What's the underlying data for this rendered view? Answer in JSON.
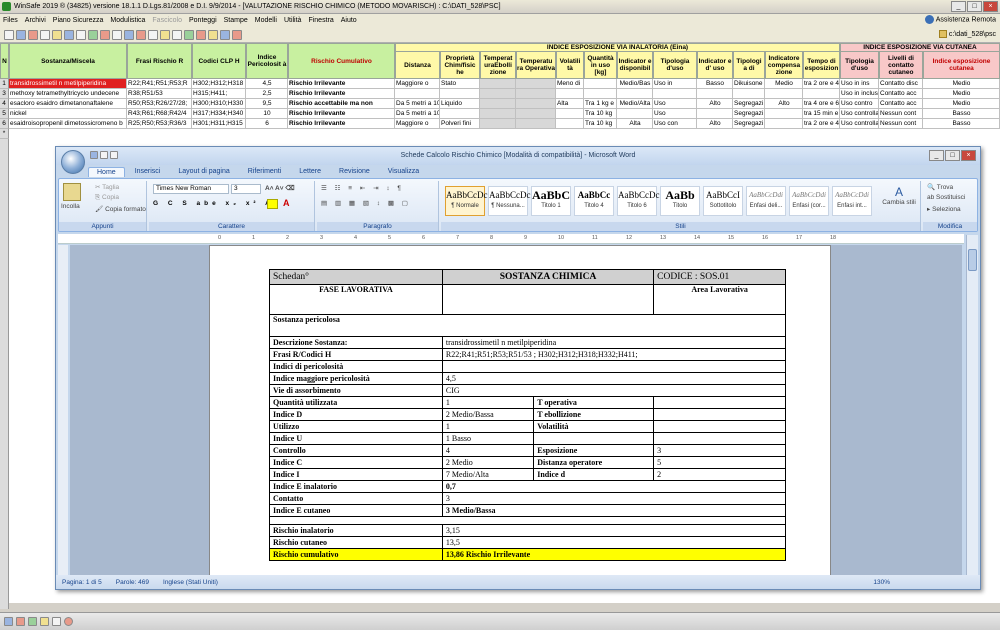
{
  "app": {
    "title": "WinSafe 2019 ®     (34825)  versione 18.1.1   D.Lgs.81/2008 e D.I. 9/9/2014 - [VALUTAZIONE RISCHIO CHIMICO (METODO MOVARISCH) : C:\\DATI_528\\PSC]"
  },
  "menu": [
    "Files",
    "Archivi",
    "Piano Sicurezza",
    "Modulistica",
    "Fascicolo",
    "Ponteggi",
    "Stampe",
    "Modelli",
    "Utilità",
    "Finestra",
    "Aiuto"
  ],
  "menu_disabled": "Fascicolo",
  "assist": "Assistenza Remota",
  "path": "c:\\dati_528\\psc",
  "grid": {
    "group_inhal": "INDICE ESPOSIZIONE VIA INALATORIA (Eina)",
    "group_cut": "INDICE ESPOSIZIONE VIA CUTANEA",
    "headers": {
      "n": "N",
      "sost": "Sostanza/Miscela",
      "frasi": "Frasi Rischio R",
      "clp": "Codici CLP  H",
      "ind": "Indice Pericolosit à",
      "risk": "Rischio Cumulativo",
      "dist": "Distanza",
      "prop": "Proprietà Chim/fisic he",
      "teb": "Temperat uraEbolli zione",
      "top": "Temperatu ra Operativa",
      "vol": "Volatili tà",
      "qta": "Quantità in uso [kg]",
      "ind2": "Indicator e disponibil",
      "tip": "Tipologia d'uso",
      "ind3": "Indicator e d' uso",
      "tip2": "Tipologi a di",
      "comp": "Indicatore compensa zione",
      "tempo": "Tempo di esposizion",
      "tip3": "Tipologia d'uso",
      "liv": "Livelli di contatto cutaneo",
      "icut": "Indice esposizione cutanea"
    },
    "rows": [
      {
        "n": "1",
        "sost": "transidrossimetil n metilpiperidina",
        "frasi": "R22;R41;R51;R53;R",
        "clp": "H302;H312;H318",
        "ind": "4,5",
        "risk": "Rischio Irrilevante",
        "dist": "Maggiore o",
        "prop": "Stato",
        "vol": "Meno di",
        "ind2": "Medio/Bas",
        "tip": "Uso in",
        "ind3": "Basso",
        "tip2": "Dikuisone",
        "comp": "Medio",
        "tempo": "tra 2 ore e 4",
        "tip3": "Uso in ins",
        "liv": "Contatto disc",
        "icut": "Medio"
      },
      {
        "n": "3",
        "sost": "methoxy tetramethyltricyclo undecene",
        "frasi": "R38;R51/53",
        "clp": "H315;H411;",
        "ind": "2,5",
        "risk": "Rischio Irrilevante",
        "tip3": "Uso in inclus",
        "liv": "Contatto acc",
        "icut": "Medio"
      },
      {
        "n": "4",
        "sost": "esacloro esaidro dimetanonaftalene",
        "frasi": "R50;R53;R26/27/28;",
        "clp": "H300;H310;H330",
        "ind": "9,5",
        "risk": "Rischio accettabile ma non",
        "dist": "Da 5 metri a 10",
        "prop": "Liquido",
        "vol": "Alta",
        "qta": "Tra 1 kg e",
        "ind2": "Medio/Alta",
        "tip": "Uso",
        "ind3": "Alto",
        "tip2": "Segregazi",
        "comp": "Alto",
        "tempo": "tra 4 ore e 6",
        "tip3": "Uso contro",
        "liv": "Contatto acc",
        "icut": "Medio"
      },
      {
        "n": "5",
        "sost": "nickel",
        "frasi": "R43;R61;R68;R42/4",
        "clp": "H317;H334;H340",
        "ind": "10",
        "risk": "Rischio Irrilevante",
        "dist": "Da 5 metri a 10",
        "qta": "Tra  10 kg",
        "tip": "Uso",
        "tip2": "Segregazi",
        "tempo": "tra 15 min e",
        "tip3": "Uso controlla",
        "liv": "Nessun cont",
        "icut": "Basso"
      },
      {
        "n": "6",
        "sost": "esaidroisopropenil dimetossicromeno b",
        "frasi": "R25;R50;R53;R36/3",
        "clp": "H301;H311;H315",
        "ind": "6",
        "risk": "Rischio Irrilevante",
        "dist": "Maggiore o",
        "prop": "Polveri fini",
        "qta": "Tra  10 kg",
        "ind2": "Alta",
        "tip": "Uso con",
        "ind3": "Alto",
        "tip2": "Segregazi",
        "tempo": "tra 2 ore e 4",
        "tip3": "Uso controlla",
        "liv": "Nessun cont",
        "icut": "Basso"
      }
    ]
  },
  "word": {
    "title": "Schede Calcolo Rischio Chimico [Modalità di compatibilità] - Microsoft Word",
    "tabs": [
      "Home",
      "Inserisci",
      "Layout di pagina",
      "Riferimenti",
      "Lettere",
      "Revisione",
      "Visualizza"
    ],
    "clip": {
      "paste": "Incolla",
      "cut": "Taglia",
      "copy": "Copia",
      "fmt": "Copia formato",
      "label": "Appunti"
    },
    "font": {
      "name": "Times New Roman",
      "size": "3",
      "label": "Carattere"
    },
    "para_label": "Paragrafo",
    "styles": [
      {
        "pv": "AaBbCcDc",
        "nm": "¶ Normale"
      },
      {
        "pv": "AaBbCcDc",
        "nm": "¶ Nessuna..."
      },
      {
        "pv": "AaBbC",
        "nm": "Titolo 1"
      },
      {
        "pv": "AaBbCc",
        "nm": "Titolo 4"
      },
      {
        "pv": "AaBbCcDc",
        "nm": "Titolo 6"
      },
      {
        "pv": "AaBb",
        "nm": "Titolo"
      },
      {
        "pv": "AaBbCcI",
        "nm": "Sottotitolo"
      },
      {
        "pv": "AaBbCcDdi",
        "nm": "Enfasi deli..."
      },
      {
        "pv": "AaBbCcDdi",
        "nm": "Enfasi (cor..."
      },
      {
        "pv": "AaBbCcDdi",
        "nm": "Enfasi int..."
      }
    ],
    "styles_label": "Stili",
    "change_styles": "Cambia stili",
    "edit": {
      "find": "Trova",
      "replace": "Sostituisci",
      "select": "Seleziona",
      "label": "Modifica"
    },
    "status": {
      "page": "Pagina: 1 di 5",
      "words": "Parole: 469",
      "lang": "Inglese (Stati Uniti)",
      "zoom": "130%"
    },
    "doc": {
      "h_scheda": "Schedan°",
      "h_sost": "SOSTANZA CHIMICA",
      "h_cod": "CODICE : SOS.01",
      "fase": "FASE LAVORATIVA",
      "area": "Area Lavorativa",
      "sost_per": "Sostanza pericolosa",
      "rows": [
        [
          "Descrizione Sostanza:",
          "transidrossimetil n metilpiperidina"
        ],
        [
          "Frasi R/Codici H",
          "R22;R41;R51;R53;R51/53 ; H302;H312;H318;H332;H411;"
        ],
        [
          "Indici di pericolosità",
          ""
        ],
        [
          "Indice maggiore pericolosità",
          "4,5"
        ],
        [
          "Vie di assorbimento",
          "CIG"
        ]
      ],
      "q": [
        [
          "Quantità utilizzata",
          "1",
          "T operativa",
          ""
        ],
        [
          "Indice D",
          "2     Medio/Bassa",
          "T ebollizione",
          ""
        ],
        [
          "Utilizzo",
          "1",
          "Volatilità",
          ""
        ],
        [
          "Indice U",
          "1     Basso",
          "",
          ""
        ],
        [
          "Controllo",
          "4",
          "Esposizione",
          "3"
        ],
        [
          "Indice C",
          "2     Medio",
          "Distanza operatore",
          "5"
        ],
        [
          "Indice I",
          "7     Medio/Alta",
          "Indice d",
          "2"
        ]
      ],
      "e_inal": [
        "Indice E inalatorio",
        "0,7"
      ],
      "contatto": [
        "Contatto",
        "3"
      ],
      "e_cut": [
        "Indice E cutaneo",
        "3     Medio/Bassa"
      ],
      "r_inal": [
        "Rischio inalatorio",
        "3,15"
      ],
      "r_cut": [
        "Rischio cutaneo",
        "13,5"
      ],
      "r_cum": [
        "Rischio cumulativo",
        "13,86     Rischio  Irrilevante"
      ]
    }
  }
}
